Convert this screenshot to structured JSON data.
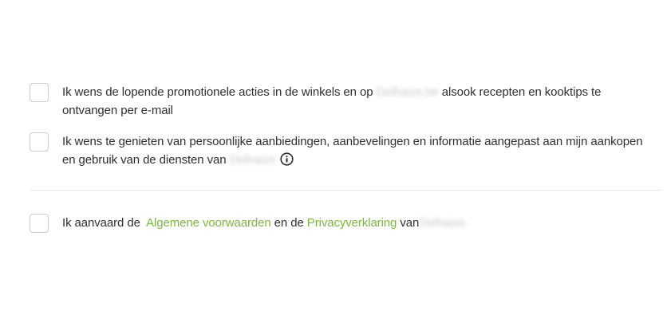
{
  "consents": [
    {
      "text_before": "Ik wens de lopende promotionele acties in de winkels en op",
      "blurred": "Delhaize.be",
      "text_after": "alsook recepten en kooktips te ontvangen per e-mail"
    },
    {
      "text_before": "Ik wens te genieten van persoonlijke aanbiedingen, aanbevelingen en informatie aangepast aan mijn aankopen en gebruik van de diensten van",
      "blurred": "Delhaize",
      "info_icon": "info-circle-icon"
    },
    {
      "text_before": "Ik aanvaard de",
      "link1": "Algemene voorwaarden",
      "text_middle": "en de",
      "link2": "Privacyverklaring",
      "text_after": "van",
      "blurred": "Delhaize."
    }
  ],
  "colors": {
    "link_green": "#79b93a",
    "text": "#2f2f2f",
    "checkbox_border": "#c8cdd2",
    "divider": "#e6e8ea"
  }
}
